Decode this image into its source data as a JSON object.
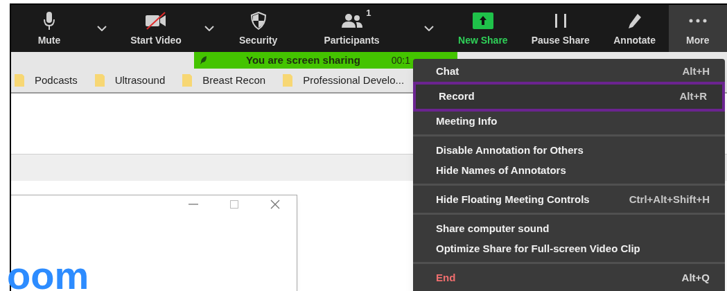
{
  "toolbar": [
    {
      "kind": "mic",
      "label": "Mute",
      "selected": false
    },
    {
      "kind": "caret"
    },
    {
      "kind": "video-off",
      "label": "Start Video",
      "selected": false
    },
    {
      "kind": "caret"
    },
    {
      "kind": "shield",
      "label": "Security",
      "selected": false
    },
    {
      "kind": "people",
      "label": "Participants",
      "count": "1",
      "selected": false
    },
    {
      "kind": "caret"
    },
    {
      "kind": "share",
      "label": "New Share",
      "selected": false
    },
    {
      "kind": "pause",
      "label": "Pause Share",
      "selected": false
    },
    {
      "kind": "pencil",
      "label": "Annotate",
      "selected": false
    },
    {
      "kind": "dots",
      "label": "More",
      "selected": true
    }
  ],
  "sharing_banner": {
    "text": "You are screen sharing",
    "timer": "00:1"
  },
  "bookmarks": [
    "Podcasts",
    "Ultrasound",
    "Breast Recon",
    "Professional Develo..."
  ],
  "window": {
    "logo": "oom"
  },
  "menu": [
    [
      {
        "label": "Chat",
        "shortcut": "Alt+H",
        "kind": "normal",
        "selected": false
      },
      {
        "label": "Record",
        "shortcut": "Alt+R",
        "kind": "normal",
        "selected": true
      },
      {
        "label": "Meeting Info",
        "kind": "normal",
        "selected": false
      }
    ],
    [
      {
        "label": "Disable Annotation for Others",
        "kind": "normal",
        "selected": false
      },
      {
        "label": "Hide Names of Annotators",
        "kind": "normal",
        "selected": false
      }
    ],
    [
      {
        "label": "Hide Floating Meeting Controls",
        "shortcut": "Ctrl+Alt+Shift+H",
        "kind": "normal",
        "selected": false
      }
    ],
    [
      {
        "label": "Share computer sound",
        "kind": "normal",
        "selected": false
      },
      {
        "label": "Optimize Share for Full-screen Video Clip",
        "kind": "normal",
        "selected": false
      }
    ],
    [
      {
        "label": "End",
        "shortcut": "Alt+Q",
        "kind": "danger",
        "selected": false
      }
    ]
  ]
}
